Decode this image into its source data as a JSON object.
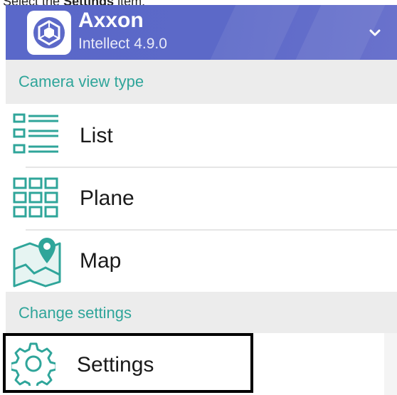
{
  "caption": {
    "prefix": "Select the ",
    "bold": "Settings",
    "suffix": " item."
  },
  "header": {
    "app_name": "Axxon",
    "app_version": "Intellect 4.9.0",
    "logo_icon": "axxon-logo-icon",
    "expand_icon": "chevron-down-icon",
    "background_color": "#5c69c8"
  },
  "sections": [
    {
      "title": "Camera view type"
    },
    {
      "title": "Change settings"
    }
  ],
  "menu": {
    "list": {
      "label": "List",
      "icon": "list-icon"
    },
    "plane": {
      "label": "Plane",
      "icon": "grid-icon"
    },
    "map": {
      "label": "Map",
      "icon": "map-pin-icon"
    },
    "settings": {
      "label": "Settings",
      "icon": "gear-icon"
    }
  },
  "colors": {
    "accent": "#2fa59a",
    "section_bg": "#ececec"
  }
}
